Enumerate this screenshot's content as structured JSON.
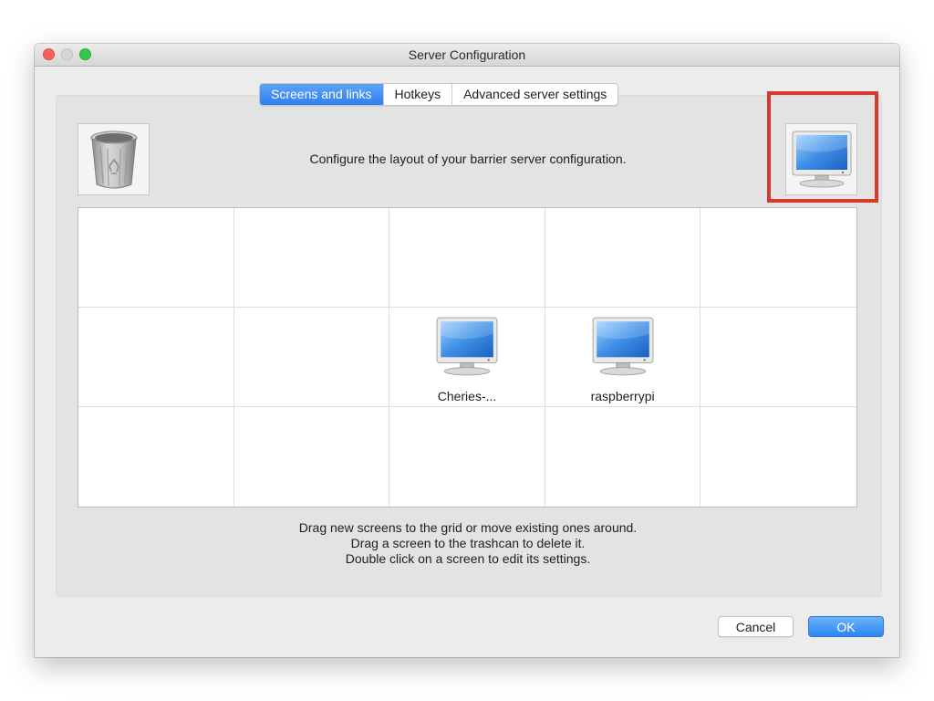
{
  "window": {
    "title": "Server Configuration"
  },
  "tabs": [
    {
      "label": "Screens and links",
      "active": true
    },
    {
      "label": "Hotkeys",
      "active": false
    },
    {
      "label": "Advanced server settings",
      "active": false
    }
  ],
  "layout_description": "Configure the layout of your barrier server configuration.",
  "icons": {
    "trash": "trashcan-icon",
    "new_screen": "monitor-icon"
  },
  "highlight_color": "#d6392d",
  "grid": {
    "columns": 5,
    "rows": 3,
    "screens": [
      {
        "label": "Cheries-...",
        "row": 1,
        "col": 2
      },
      {
        "label": "raspberrypi",
        "row": 1,
        "col": 3
      }
    ]
  },
  "help_lines": [
    "Drag new screens to the grid or move existing ones around.",
    "Drag a screen to the trashcan to delete it.",
    "Double click on a screen to edit its settings."
  ],
  "buttons": {
    "cancel": "Cancel",
    "ok": "OK"
  },
  "colors": {
    "accent": "#2e7ff0",
    "window_bg": "#ececec",
    "panel_bg": "#e3e3e3"
  }
}
